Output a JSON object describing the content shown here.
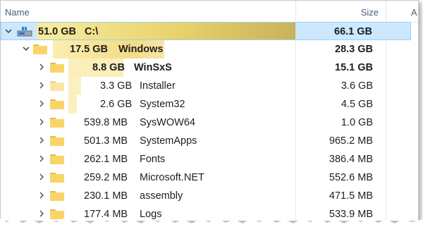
{
  "header": {
    "name_label": "Name",
    "size_label": "Size",
    "extra_label": "A"
  },
  "colors": {
    "selection_bg": "#cce8ff",
    "bar_gold": "#e8d26a",
    "bar_pale": "#fbefc4",
    "folder": "#f9d468"
  },
  "rows": [
    {
      "indent": 0,
      "icon": "drive-icon",
      "expanded": true,
      "size": "51.0 GB",
      "name": "C:\\",
      "total": "66.1 GB",
      "bold": true
    },
    {
      "indent": 1,
      "icon": "folder-icon",
      "expanded": true,
      "size": "17.5 GB",
      "name": "Windows",
      "total": "28.3 GB",
      "bold": true
    },
    {
      "indent": 2,
      "icon": "folder-icon",
      "expanded": false,
      "size": "8.8 GB",
      "name": "WinSxS",
      "total": "15.1 GB",
      "bold": true
    },
    {
      "indent": 2,
      "icon": "folder-icon",
      "expanded": false,
      "size": "3.3 GB",
      "name": "Installer",
      "total": "3.6 GB",
      "bold": false
    },
    {
      "indent": 2,
      "icon": "folder-icon",
      "expanded": false,
      "size": "2.6 GB",
      "name": "System32",
      "total": "4.5 GB",
      "bold": false
    },
    {
      "indent": 2,
      "icon": "folder-icon",
      "expanded": false,
      "size": "539.8 MB",
      "name": "SysWOW64",
      "total": "1.0 GB",
      "bold": false
    },
    {
      "indent": 2,
      "icon": "folder-icon",
      "expanded": false,
      "size": "501.3 MB",
      "name": "SystemApps",
      "total": "965.2 MB",
      "bold": false
    },
    {
      "indent": 2,
      "icon": "folder-icon",
      "expanded": false,
      "size": "262.1 MB",
      "name": "Fonts",
      "total": "386.4 MB",
      "bold": false
    },
    {
      "indent": 2,
      "icon": "folder-icon",
      "expanded": false,
      "size": "259.2 MB",
      "name": "Microsoft.NET",
      "total": "552.6 MB",
      "bold": false
    },
    {
      "indent": 2,
      "icon": "folder-icon",
      "expanded": false,
      "size": "230.1 MB",
      "name": "assembly",
      "total": "471.5 MB",
      "bold": false
    },
    {
      "indent": 2,
      "icon": "folder-icon",
      "expanded": false,
      "size": "177.4 MB",
      "name": "Logs",
      "total": "533.9 MB",
      "bold": false
    }
  ]
}
